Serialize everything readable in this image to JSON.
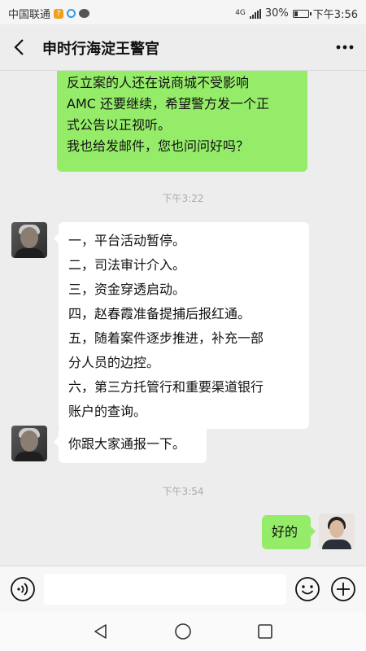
{
  "status_bar": {
    "carrier": "中国联通",
    "network": "4G",
    "battery": "30%",
    "battery_level": 0.3,
    "time": "下午3:56"
  },
  "header": {
    "title": "申时行海淀王警官",
    "back_icon": "chevron-left-icon",
    "more_icon": "more-dots-icon"
  },
  "messages": [
    {
      "sender": "me",
      "lines": [
        "反立案的人还在说商城不受影响",
        "AMC 还要继续，希望警方发一个正",
        "式公告以正视听。",
        "我也给发邮件，您也问问好吗？"
      ]
    },
    {
      "timestamp": "下午3:22"
    },
    {
      "sender": "officer",
      "lines": [
        "一，平台活动暂停。",
        "二，司法审计介入。",
        "三，资金穿透启动。",
        "四，赵春霞准备提捕后报红通。",
        "五，随着案件逐步推进，补充一部",
        "分人员的边控。",
        "六，第三方托管行和重要渠道银行",
        "账户的查询。"
      ]
    },
    {
      "sender": "officer",
      "lines": [
        "你跟大家通报一下。"
      ]
    },
    {
      "timestamp": "下午3:54"
    },
    {
      "sender": "me",
      "lines": [
        "好的"
      ]
    }
  ],
  "input_bar": {
    "voice_icon": "voice-icon",
    "placeholder": "",
    "emoji_icon": "emoji-icon",
    "plus_icon": "plus-icon"
  },
  "nav": {
    "back_icon": "nav-back-icon",
    "home_icon": "nav-home-icon",
    "recent_icon": "nav-recent-icon"
  },
  "colors": {
    "my_bubble": "#95ec69",
    "their_bubble": "#ffffff",
    "background": "#ededed"
  }
}
